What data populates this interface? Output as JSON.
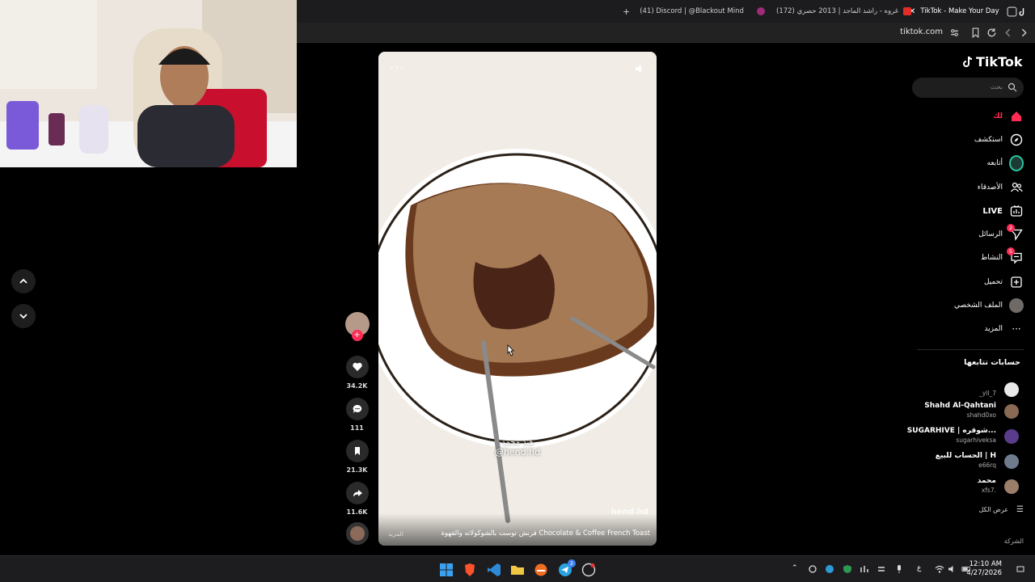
{
  "browser": {
    "tabs": [
      {
        "label": "TikTok - Make Your Day",
        "active": true
      },
      {
        "label": "(172) غروه - راشد الماجد | 2013 حصري",
        "active": false
      },
      {
        "label": "(41) Discord | @Blackout Mind",
        "active": false
      }
    ],
    "url": "tiktok.com"
  },
  "video": {
    "username_overlay": "@hend.hd",
    "username_arabic": "هند محمد",
    "watermark": "hend.hd",
    "caption": "فرنش توست بالشوكولاته والقهوة Chocolate & Coffee French Toast",
    "more_label": "المزيد"
  },
  "actions": {
    "likes": "34.2K",
    "comments": "111",
    "saves": "21.3K",
    "shares": "11.6K"
  },
  "sidebar": {
    "logo": "TikTok",
    "search_placeholder": "بحث",
    "menu": [
      {
        "label": "لك",
        "icon": "home-icon",
        "active": true
      },
      {
        "label": "استكشف",
        "icon": "compass-icon"
      },
      {
        "label": "أتابعه",
        "icon": "following-avatar-icon"
      },
      {
        "label": "الأصدقاء",
        "icon": "friends-icon"
      },
      {
        "label": "LIVE",
        "icon": "live-icon"
      },
      {
        "label": "الرسائل",
        "icon": "messages-icon",
        "badge": "2"
      },
      {
        "label": "النشاط",
        "icon": "activity-icon",
        "badge": "5"
      },
      {
        "label": "تحميل",
        "icon": "upload-icon"
      },
      {
        "label": "الملف الشخصي",
        "icon": "profile-avatar-icon"
      },
      {
        "label": "المزيد",
        "icon": "more-dots-icon"
      }
    ],
    "following_title": "حسابات تتابعها",
    "accounts": [
      {
        "name": "",
        "handle": "_yll_7",
        "color": "#e8e8e8"
      },
      {
        "name": "Shahd Al-Qahtani",
        "handle": "shahd0xo",
        "color": "#8a6a55"
      },
      {
        "name": "SUGARHIVE | شوقره...",
        "handle": "sugarhiveksa",
        "color": "#5b3c8c"
      },
      {
        "name": "الحساب للبيع | H",
        "handle": "e66rq",
        "color": "#6d7b8c"
      },
      {
        "name": "محمد",
        "handle": "xfs7.",
        "color": "#9a7e6a"
      }
    ],
    "see_all": "عرض الكل",
    "company": "الشركة"
  },
  "taskbar": {
    "time": "12:10 AM",
    "date": "4/27/2026",
    "lang": "ع",
    "telegram_badge": "2"
  }
}
